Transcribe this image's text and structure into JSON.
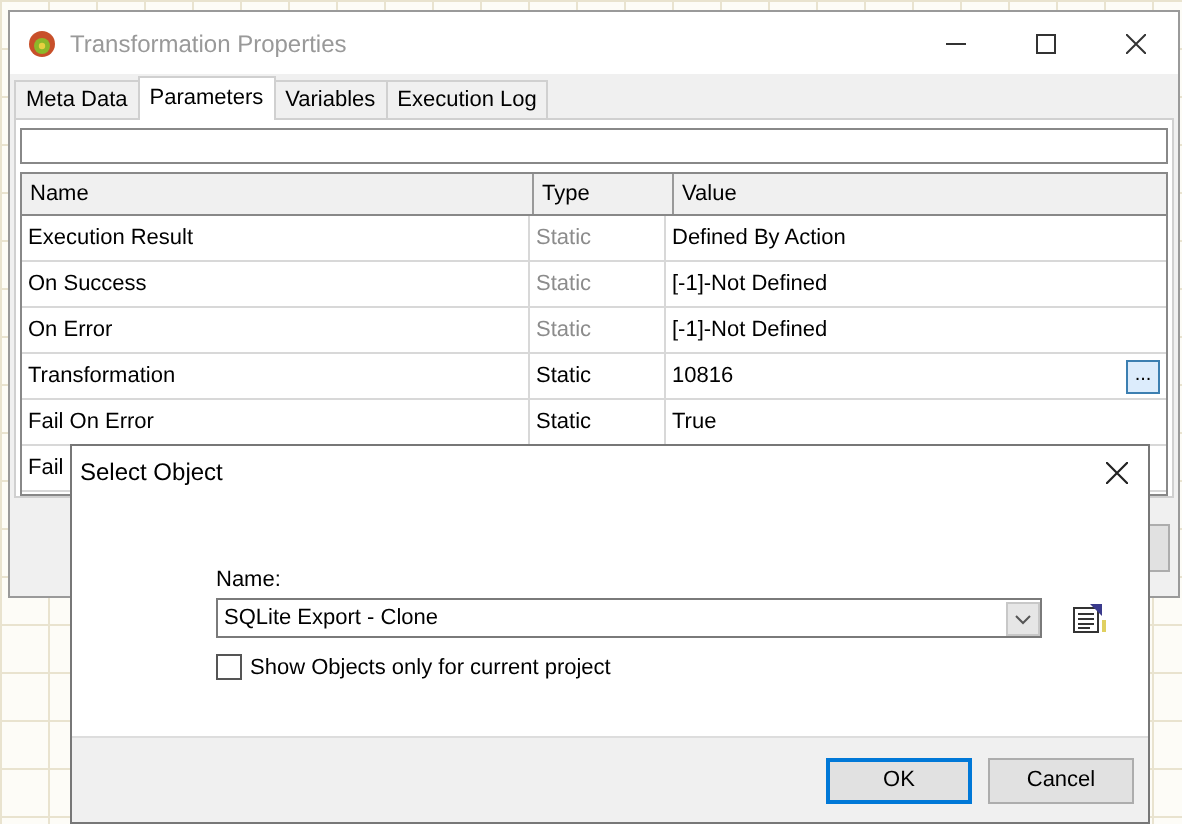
{
  "window": {
    "title": "Transformation Properties"
  },
  "tabs": [
    {
      "label": "Meta Data",
      "selected": false
    },
    {
      "label": "Parameters",
      "selected": true
    },
    {
      "label": "Variables",
      "selected": false
    },
    {
      "label": "Execution Log",
      "selected": false
    }
  ],
  "table": {
    "columns": [
      "Name",
      "Type",
      "Value"
    ],
    "rows": [
      {
        "name": "Execution Result",
        "type": "Static",
        "value": "Defined By Action",
        "disabled": true
      },
      {
        "name": "On Success",
        "type": "Static",
        "value": "[-1]-Not Defined",
        "disabled": true
      },
      {
        "name": "On Error",
        "type": "Static",
        "value": "[-1]-Not Defined",
        "disabled": true
      },
      {
        "name": "Transformation",
        "type": "Static",
        "value": "10816",
        "disabled": false,
        "browse_label": "..."
      },
      {
        "name": "Fail On Error",
        "type": "Static",
        "value": "True",
        "disabled": false
      },
      {
        "name": "Fail"
      }
    ]
  },
  "dialog": {
    "title": "Select Object",
    "name_label": "Name:",
    "name_value": "SQLite Export - Clone",
    "checkbox": {
      "label": "Show Objects only for current project",
      "checked": false
    },
    "buttons": [
      {
        "label": "OK",
        "default": true
      },
      {
        "label": "Cancel",
        "default": false
      }
    ]
  }
}
